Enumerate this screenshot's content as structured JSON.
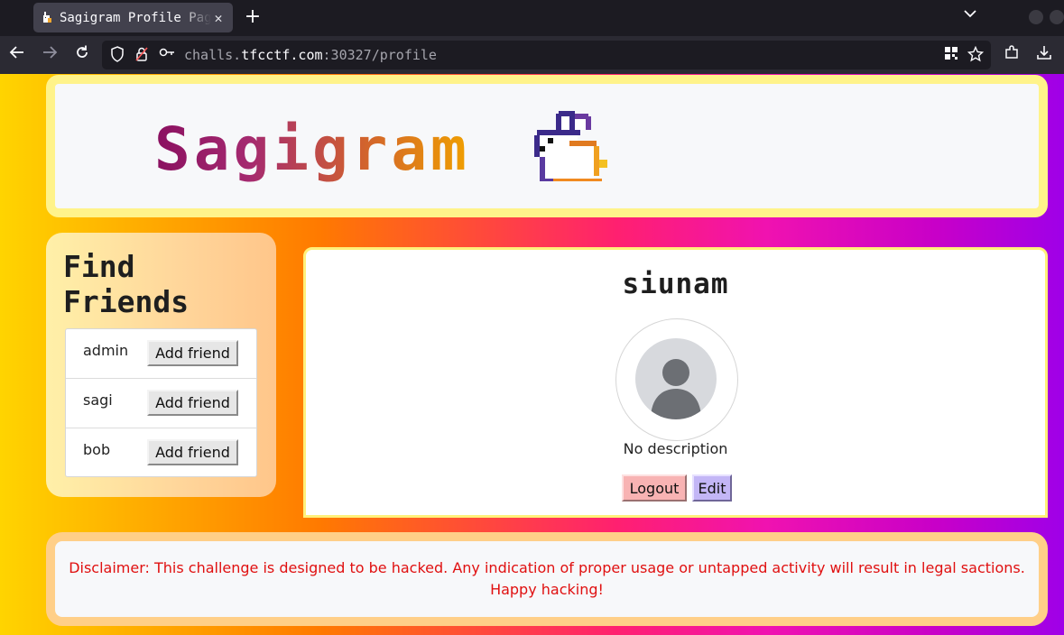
{
  "browser": {
    "tab_title": "Sagigram Profile Page",
    "tab_close_icon": "close-icon",
    "url_host_prefix": "challs.",
    "url_host": "tfcctf.com",
    "url_rest": ":30327/profile"
  },
  "header": {
    "logo_text": "Sagigram"
  },
  "sidebar": {
    "title": "Find Friends",
    "friends": [
      {
        "name": "admin",
        "button_label": "Add friend"
      },
      {
        "name": "sagi",
        "button_label": "Add friend"
      },
      {
        "name": "bob",
        "button_label": "Add friend"
      }
    ]
  },
  "profile": {
    "username": "siunam",
    "description": "No description",
    "logout_label": "Logout",
    "edit_label": "Edit"
  },
  "footer": {
    "disclaimer": "Disclaimer: This challenge is designed to be hacked. Any indication of proper usage or untapped activity will result in legal sactions. Happy hacking!"
  },
  "colors": {
    "logo_gradient_start": "#8a1060",
    "logo_gradient_end": "#f0a000",
    "disclaimer_text": "#e01010",
    "logout_button": "#f8b3b3",
    "edit_button": "#c3b6f6"
  }
}
